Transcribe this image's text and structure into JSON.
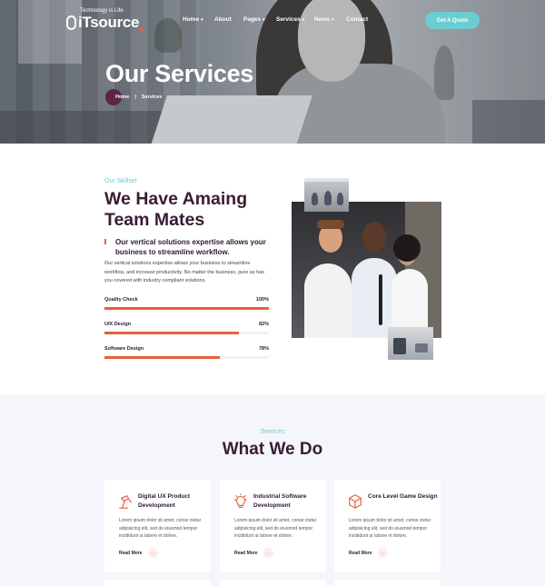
{
  "header": {
    "logo_text": "iTsource",
    "logo_tagline": "Technology is Life",
    "nav": [
      {
        "label": "Home",
        "caret": true
      },
      {
        "label": "About",
        "caret": false
      },
      {
        "label": "Pages",
        "caret": true
      },
      {
        "label": "Services",
        "caret": true
      },
      {
        "label": "News",
        "caret": true
      },
      {
        "label": "Contact",
        "caret": false
      }
    ],
    "cta_label": "Get A Quote"
  },
  "hero": {
    "title": "Our Services",
    "breadcrumb": {
      "home": "Home",
      "separator": "|",
      "current": "Services"
    }
  },
  "skillset": {
    "eyebrow": "Our Skillset",
    "title": "We Have Amaing Team Mates",
    "lead": "Our vertical solutions expertise allows your business to streamline workflow.",
    "paragraph": "Our vertical solutions expertise allows your business to streamline workflow, and increase productivity. No matter the business, pure as has you covered with industry compliant solutions.",
    "skills": [
      {
        "label": "Quality Check",
        "percent": "100%",
        "value": 100
      },
      {
        "label": "UIX Design",
        "percent": "82%",
        "value": 82
      },
      {
        "label": "Software Design",
        "percent": "78%",
        "value": 70
      }
    ]
  },
  "services": {
    "eyebrow": "Services",
    "title": "What We Do",
    "cards": [
      {
        "title": "Digital UX Product Development",
        "icon": "lamp-icon",
        "body": "Lorem ipsum dolor sit amet, conse ctetur adipisicing elit, sed do eiusmod tempor incididunt ut labore et dolore.",
        "more": "Read More"
      },
      {
        "title": "Industrial Software Development",
        "icon": "lightbulb-icon",
        "body": "Lorem ipsum dolor sit amet, conse ctetur adipisicing elit, sed do eiusmod tempor incididunt ut labore et dolore.",
        "more": "Read More"
      },
      {
        "title": "Core Level Game Design",
        "icon": "cube-icon",
        "body": "Lorem ipsum dolor sit amet, conse ctetur adipisicing elit, sed do eiusmod tempor incididunt ut labore et dolore.",
        "more": "Read More"
      }
    ]
  },
  "colors": {
    "accent": "#e8603c",
    "teal": "#6ccdd0",
    "plum": "#3a1c33",
    "bubble": "#5b2449"
  }
}
